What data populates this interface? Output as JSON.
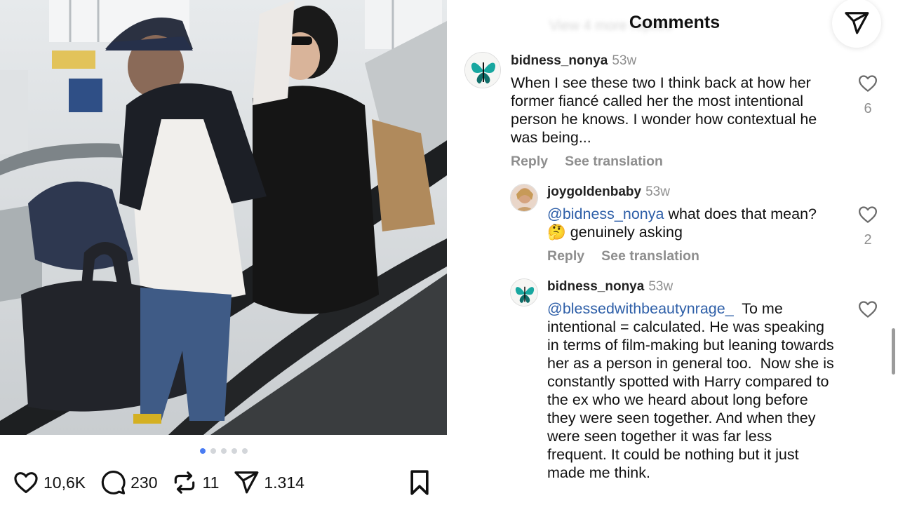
{
  "post": {
    "carousel": {
      "count": 5,
      "active_index": 0
    },
    "actions": {
      "likes": "10,6K",
      "comments": "230",
      "reposts": "11",
      "shares": "1.314"
    }
  },
  "comments_panel": {
    "title": "Comments",
    "faded_top_text": "View 4 more replies",
    "comments": [
      {
        "username": "bidness_nonya",
        "time": "53w",
        "text": "When I see these two I think back at how her former fiancé called her the most intentional person he knows. I wonder how contextual he was being...",
        "reply_label": "Reply",
        "translate_label": "See translation",
        "likes": "6"
      },
      {
        "username": "joygoldenbaby",
        "time": "53w",
        "mention": "@bidness_nonya",
        "text_before_emoji": " what does that mean?",
        "emoji": "🤔",
        "text_after_emoji": " genuinely asking",
        "reply_label": "Reply",
        "translate_label": "See translation",
        "likes": "2"
      },
      {
        "username": "bidness_nonya",
        "time": "53w",
        "mention": "@blessedwithbeautynrage_",
        "text": "  To me intentional = calculated. He was speaking in terms of film-making but leaning towards her as a person in general too.  Now she is constantly spotted with Harry compared to the ex who we heard about long before they were seen together. And when they were seen together it was far less frequent. It could be nothing but it just made me think."
      }
    ]
  },
  "icons": {
    "like": "heart-icon",
    "comment": "comment-bubble-icon",
    "repost": "repost-icon",
    "share": "send-icon",
    "save": "bookmark-icon"
  },
  "colors": {
    "mention": "#2e5fa8",
    "muted": "#8e8e8e",
    "carousel_active": "#4a7cf3"
  }
}
